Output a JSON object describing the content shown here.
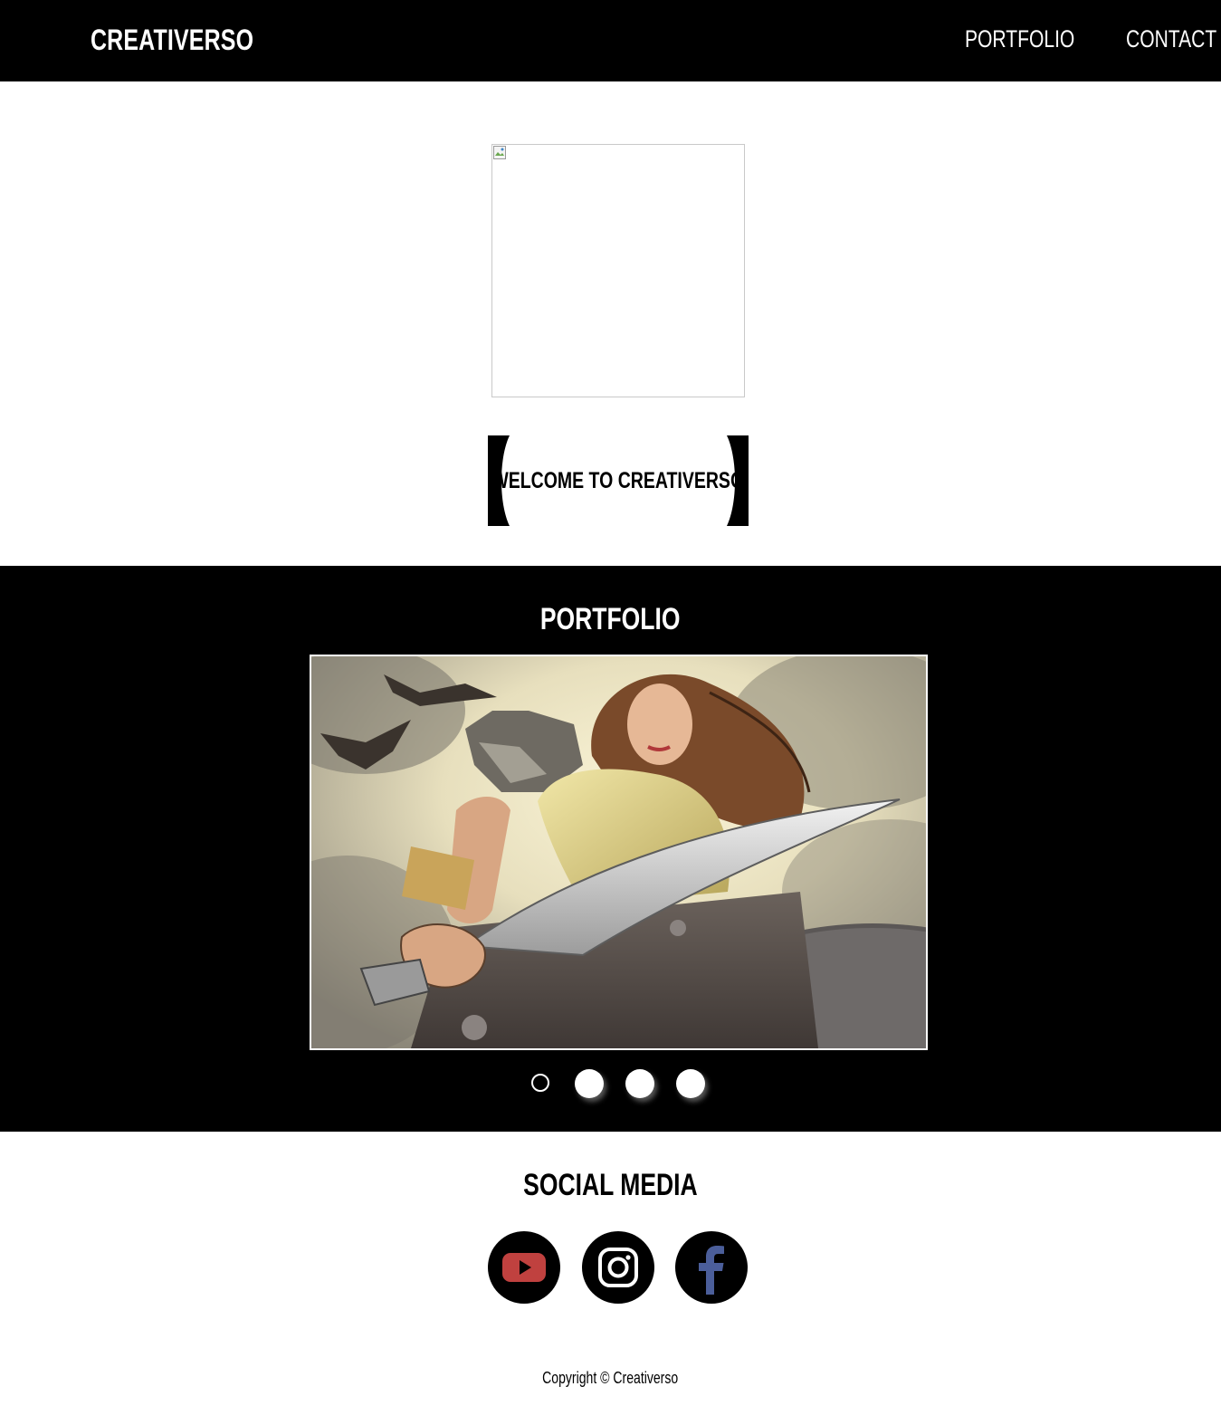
{
  "nav": {
    "brand": "CREATIVERSO",
    "links": [
      "PORTFOLIO",
      "CONTACT"
    ]
  },
  "hero": {
    "image_state": "broken-image",
    "welcome": "WELCOME TO CREATIVERSO"
  },
  "portfolio": {
    "title": "PORTFOLIO",
    "slide_description": "comic-style illustration of a warrior woman with a wolf pelt and sword",
    "slide_count": 4,
    "active_slide": 1
  },
  "social": {
    "title": "SOCIAL MEDIA",
    "icons": [
      "youtube-icon",
      "instagram-icon",
      "facebook-icon"
    ],
    "colors": {
      "youtube": "#c0413f",
      "instagram": "#ffffff",
      "facebook": "#4b5e9a"
    }
  },
  "footer": {
    "copyright": "Copyright © Creativerso"
  },
  "colors": {
    "dark": "#000000",
    "light": "#ffffff"
  }
}
